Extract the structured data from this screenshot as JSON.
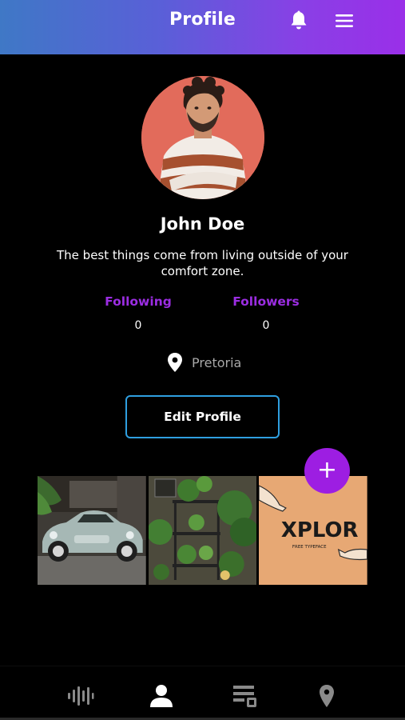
{
  "header": {
    "title": "Profile",
    "bell_icon": "bell-icon",
    "menu_icon": "hamburger-menu-icon"
  },
  "profile": {
    "name": "John Doe",
    "bio": "The best things come from living outside of your comfort zone.",
    "following_label": "Following",
    "following_count": "0",
    "followers_label": "Followers",
    "followers_count": "0",
    "location": "Pretoria",
    "edit_button": "Edit Profile"
  },
  "fab": {
    "label": "+"
  },
  "gallery": {
    "tiles": [
      {
        "subject": "vintage convertible car"
      },
      {
        "subject": "indoor plants on shelves"
      },
      {
        "subject": "typeface poster",
        "text": "XPLOR",
        "subtext": "FREE TYPEFACE"
      }
    ]
  },
  "bottom_nav": {
    "items": [
      {
        "icon": "sound-waves-icon",
        "active": false
      },
      {
        "icon": "person-icon",
        "active": true
      },
      {
        "icon": "list-icon",
        "active": false
      },
      {
        "icon": "map-pin-icon",
        "active": false
      }
    ]
  },
  "colors": {
    "accent": "#9b2de2",
    "fab": "#9d1ee2",
    "button_border": "#2f9fe0",
    "header_gradient_start": "#3f78c6",
    "header_gradient_end": "#9a2fe8",
    "inactive_icon": "#8a8a8a"
  }
}
